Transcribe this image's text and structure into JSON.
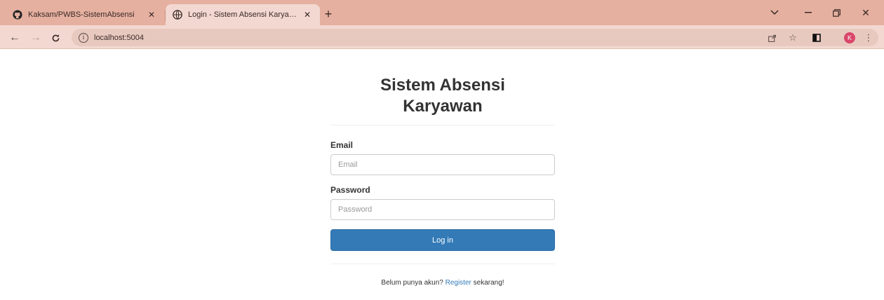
{
  "browser": {
    "tabs": [
      {
        "title": "Kaksam/PWBS-SistemAbsensi",
        "favicon": "github-icon",
        "active": false
      },
      {
        "title": "Login - Sistem Absensi Karyawan",
        "favicon": "globe-icon",
        "active": true
      }
    ],
    "address_bar": {
      "url": "localhost:5004"
    },
    "profile_initial": "K"
  },
  "login": {
    "heading": "Sistem Absensi Karyawan",
    "email_label": "Email",
    "email_placeholder": "Email",
    "password_label": "Password",
    "password_placeholder": "Password",
    "submit_label": "Log in",
    "footer_prefix": "Belum punya akun?",
    "register_link": "Register",
    "footer_suffix": "sekarang!"
  },
  "colors": {
    "titlebar": "#e5b0a0",
    "toolbar": "#f2d8d0",
    "primary_button": "#337ab7"
  }
}
